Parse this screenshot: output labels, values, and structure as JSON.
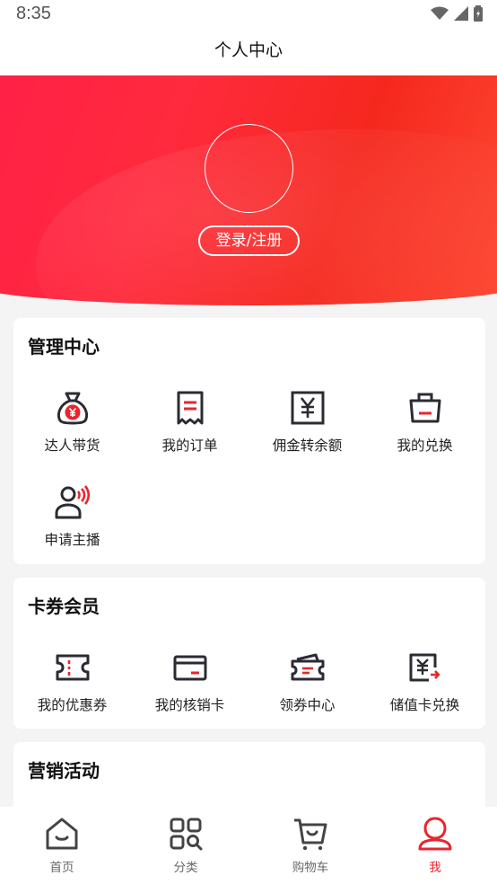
{
  "status": {
    "time": "8:35"
  },
  "header": {
    "title": "个人中心"
  },
  "profile": {
    "login_label": "登录/注册"
  },
  "management": {
    "title": "管理中心",
    "items": [
      {
        "label": "达人带货",
        "icon": "money-bag-icon"
      },
      {
        "label": "我的订单",
        "icon": "receipt-icon"
      },
      {
        "label": "佣金转余额",
        "icon": "yen-icon"
      },
      {
        "label": "我的兑换",
        "icon": "shopping-bag-icon"
      },
      {
        "label": "申请主播",
        "icon": "streamer-icon"
      }
    ]
  },
  "cards": {
    "title": "卡券会员",
    "items": [
      {
        "label": "我的优惠券",
        "icon": "ticket-icon"
      },
      {
        "label": "我的核销卡",
        "icon": "card-icon"
      },
      {
        "label": "领券中心",
        "icon": "coupons-icon"
      },
      {
        "label": "储值卡兑换",
        "icon": "stored-value-card-icon"
      }
    ]
  },
  "marketing": {
    "title": "营销活动"
  },
  "tabbar": {
    "items": [
      {
        "label": "首页",
        "icon": "home-icon",
        "active": false
      },
      {
        "label": "分类",
        "icon": "category-icon",
        "active": false
      },
      {
        "label": "购物车",
        "icon": "cart-icon",
        "active": false
      },
      {
        "label": "我",
        "icon": "user-icon",
        "active": true
      }
    ]
  },
  "colors": {
    "accent": "#e8262d",
    "icon_stroke": "#2b2b33",
    "hero_start": "#ff1f48",
    "hero_end": "#ff4d36"
  }
}
